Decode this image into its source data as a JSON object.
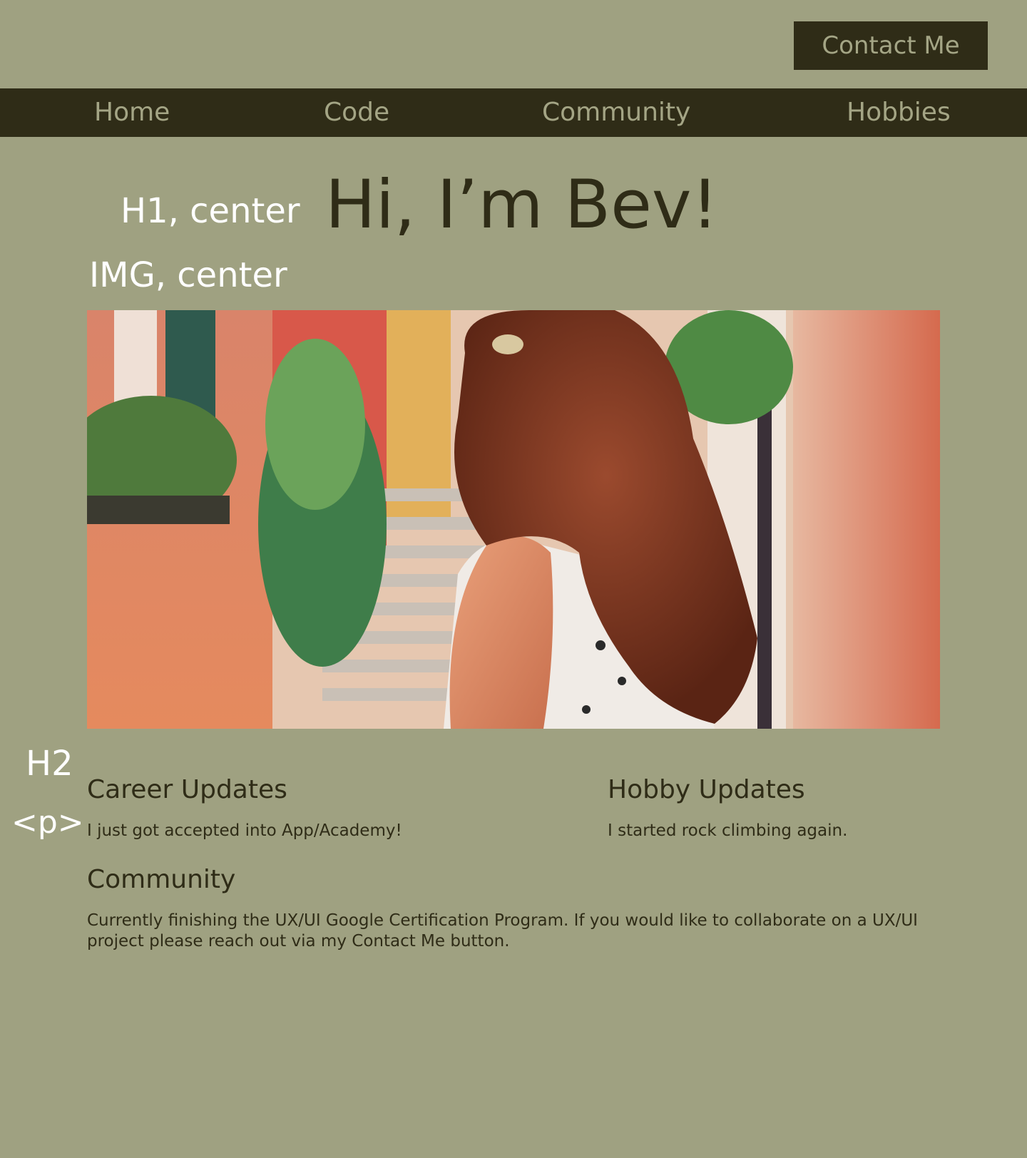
{
  "header": {
    "contact_label": "Contact Me"
  },
  "nav": {
    "items": [
      {
        "label": "Home"
      },
      {
        "label": "Code"
      },
      {
        "label": "Community"
      },
      {
        "label": "Hobbies"
      }
    ]
  },
  "annotations": {
    "h1": "H1, center",
    "img": "IMG, center",
    "h2": "H2",
    "p": "<p>"
  },
  "hero": {
    "title": "Hi, I’m Bev!"
  },
  "sections": {
    "career": {
      "title": "Career Updates",
      "text": "I just got accepted into App/Academy!"
    },
    "hobby": {
      "title": "Hobby Updates",
      "text": "I started rock climbing again."
    },
    "community": {
      "title": "Community",
      "text": "Currently finishing the UX/UI Google Certification Program. If you would like to collaborate on a UX/UI project please reach out via my Contact Me button."
    }
  },
  "colors": {
    "background": "#9fa181",
    "dark": "#2f2c17",
    "nav_text": "#a4a585",
    "annotation": "#ffffff"
  }
}
